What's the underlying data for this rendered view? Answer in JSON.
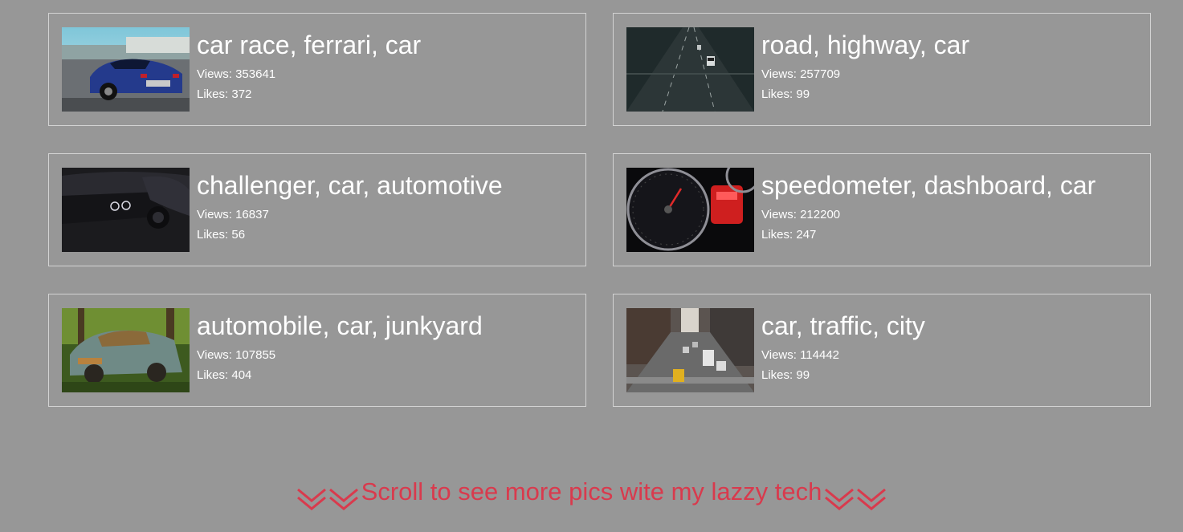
{
  "cards": [
    {
      "title": "car race, ferrari, car",
      "views": "Views: 353641",
      "likes": "Likes: 372",
      "image_icon": "blue-sports-car-photo"
    },
    {
      "title": "road, highway, car",
      "views": "Views: 257709",
      "likes": "Likes: 99",
      "image_icon": "highway-road-photo"
    },
    {
      "title": "challenger, car, automotive",
      "views": "Views: 16837",
      "likes": "Likes: 56",
      "image_icon": "dark-challenger-car-photo"
    },
    {
      "title": "speedometer, dashboard, car",
      "views": "Views: 212200",
      "likes": "Likes: 247",
      "image_icon": "speedometer-photo"
    },
    {
      "title": "automobile, car, junkyard",
      "views": "Views: 107855",
      "likes": "Likes: 404",
      "image_icon": "rusty-car-photo"
    },
    {
      "title": "car, traffic, city",
      "views": "Views: 114442",
      "likes": "Likes: 99",
      "image_icon": "city-traffic-photo"
    }
  ],
  "footer": {
    "text": "Scroll to see more pics wite my lazzy tech",
    "icon": "double-chevron-down-icon"
  },
  "colors": {
    "background": "#979797",
    "border": "#d3d3d3",
    "text": "#ffffff",
    "accent": "#d93a4d"
  }
}
